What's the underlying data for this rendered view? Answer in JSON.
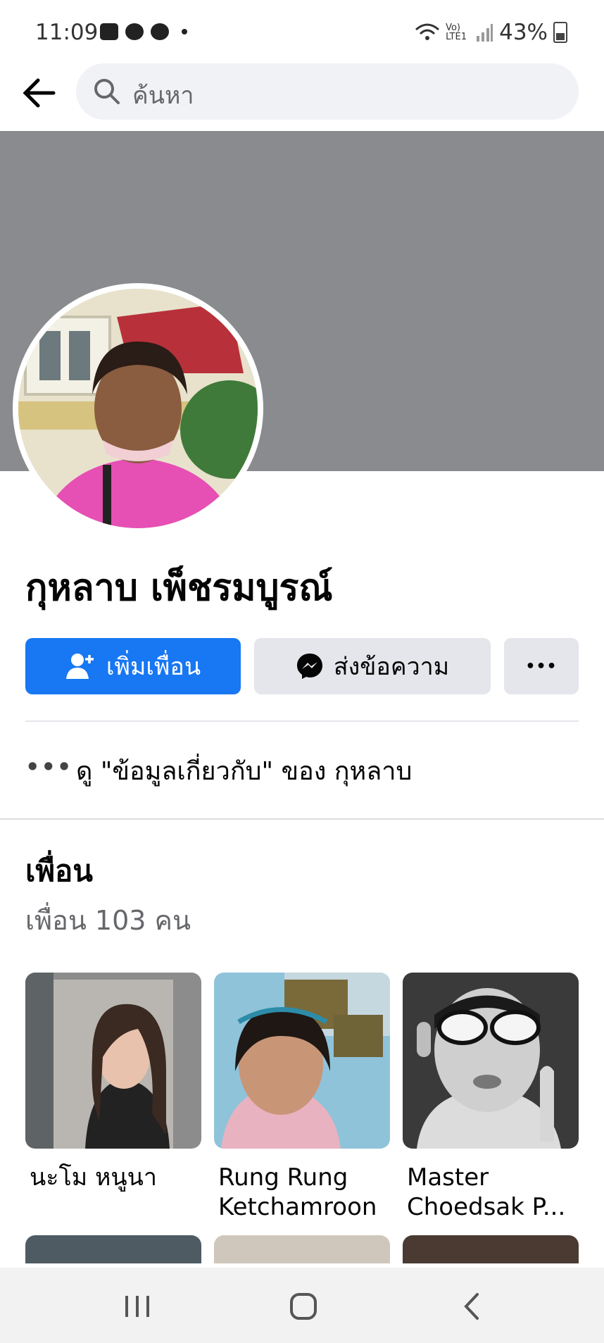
{
  "status_bar": {
    "time": "11:09",
    "left_icons": [
      "image-icon",
      "line-icon",
      "messenger-icon"
    ],
    "network": "Vo) LTE1",
    "battery_percent": "43%"
  },
  "search": {
    "placeholder": "ค้นหา"
  },
  "profile": {
    "name": "กุหลาบ เพ็ชรมบูรณ์",
    "add_friend_label": "เพิ่มเพื่อน",
    "message_label": "ส่งข้อความ",
    "more_label": "•••"
  },
  "about": {
    "dots": "•••",
    "text": "ดู \"ข้อมูลเกี่ยวกับ\" ของ กุหลาบ"
  },
  "friends": {
    "title": "เพื่อน",
    "count_text": "เพื่อน 103 คน",
    "items": [
      {
        "line1": "นะโม หนูนา",
        "line2": ""
      },
      {
        "line1": "Rung Rung",
        "line2": "Ketchamroon"
      },
      {
        "line1": "Master",
        "line2": "Choedsak P..."
      }
    ]
  },
  "colors": {
    "brand_blue": "#1877f2",
    "cover_gray": "#898b8e",
    "button_gray": "#e4e6eb"
  }
}
